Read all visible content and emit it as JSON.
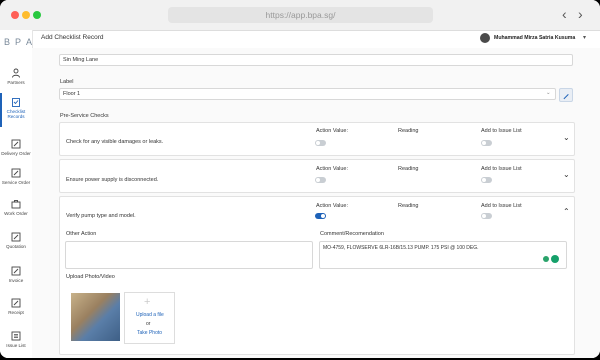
{
  "browser": {
    "url": "https://app.bpa.sg/",
    "back": "‹",
    "forward": "›"
  },
  "brand": [
    "B",
    "P",
    "A"
  ],
  "sidebar": {
    "items": [
      {
        "label": "Partners",
        "icon": "person-icon"
      },
      {
        "label": "Checklist Records",
        "icon": "clipboard-icon"
      },
      {
        "label": "Delivery Order",
        "icon": "edit-icon"
      },
      {
        "label": "Service Order",
        "icon": "edit-icon"
      },
      {
        "label": "Work Order",
        "icon": "briefcase-icon"
      },
      {
        "label": "Quotation",
        "icon": "edit-icon"
      },
      {
        "label": "Invoice",
        "icon": "edit-icon"
      },
      {
        "label": "Receipt",
        "icon": "edit-icon"
      },
      {
        "label": "Issue List",
        "icon": "list-icon"
      }
    ]
  },
  "header": {
    "title": "Add Checklist Record",
    "user": "Muhammad Mirza Satria Kusuma"
  },
  "form": {
    "location_value": "Sin Ming Lane",
    "label_title": "Label",
    "label_value": "Floor 1",
    "section_title": "Pre-Service Checks",
    "col_action": "Action Value:",
    "col_reading": "Reading",
    "col_issue": "Add to Issue List",
    "checks": [
      {
        "text": "Check for any visible damages or leaks.",
        "action": false,
        "issue": false
      },
      {
        "text": "Ensure power supply is disconnected.",
        "action": false,
        "issue": false
      },
      {
        "text": "Verify pump type and model.",
        "action": true,
        "issue": false
      }
    ],
    "other_action_label": "Other Action",
    "comment_label": "Comment/Recomendation",
    "comment_value": "MO-4759, FLOWSERVE 6LR-16B/15.13 PUMP. 175 PSI @ 100 DEG.",
    "upload_label": "Upload Photo/Video",
    "upload_file": "Upload a file",
    "upload_or": "or",
    "take_photo": "Take Photo"
  },
  "colors": {
    "accent": "#1e62b8",
    "toggle_off": "#c9ced3"
  }
}
